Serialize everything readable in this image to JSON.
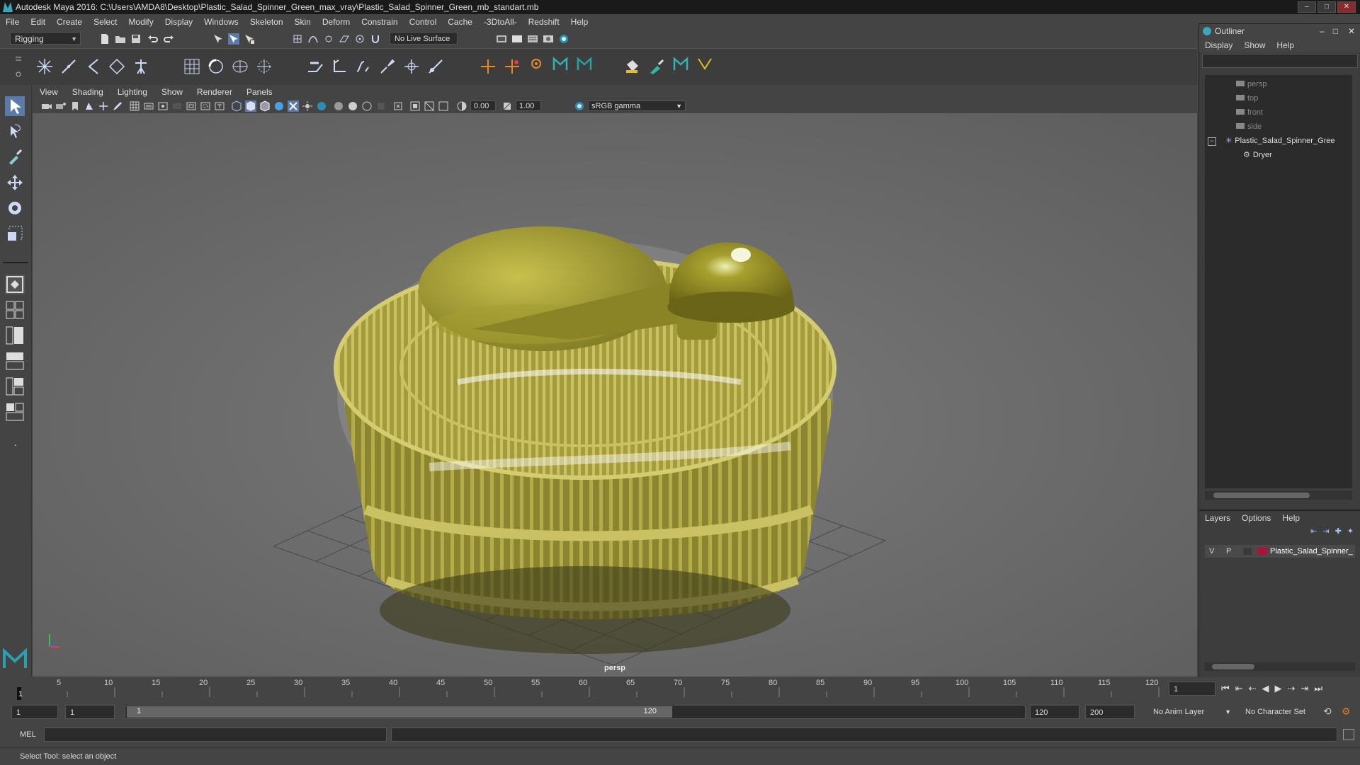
{
  "window": {
    "title": "Autodesk Maya 2016: C:\\Users\\AMDA8\\Desktop\\Plastic_Salad_Spinner_Green_max_vray\\Plastic_Salad_Spinner_Green_mb_standart.mb",
    "minimize": "–",
    "maximize": "□",
    "close": "✕"
  },
  "menubar": [
    "File",
    "Edit",
    "Create",
    "Select",
    "Modify",
    "Display",
    "Windows",
    "Skeleton",
    "Skin",
    "Deform",
    "Constrain",
    "Control",
    "Cache",
    "-3DtoAll-",
    "Redshift",
    "Help"
  ],
  "statusbar": {
    "menu_set": "Rigging",
    "live_surface": "No Live Surface"
  },
  "viewport": {
    "menu": [
      "View",
      "Shading",
      "Lighting",
      "Show",
      "Renderer",
      "Panels"
    ],
    "exposure": "0.00",
    "gamma": "1.00",
    "color_space": "sRGB gamma",
    "camera_label": "persp"
  },
  "outliner": {
    "title": "Outliner",
    "menu": [
      "Display",
      "Show",
      "Help"
    ],
    "items": [
      {
        "label": "persp",
        "dim": true
      },
      {
        "label": "top",
        "dim": true
      },
      {
        "label": "front",
        "dim": true
      },
      {
        "label": "side",
        "dim": true
      },
      {
        "label": "Plastic_Salad_Spinner_Gree",
        "dim": false
      },
      {
        "label": "Dryer",
        "dim": false
      }
    ]
  },
  "layers": {
    "menu": [
      "Layers",
      "Options",
      "Help"
    ],
    "layer": {
      "v": "V",
      "p": "P",
      "name": "Plastic_Salad_Spinner_",
      "color": "#b0103a"
    }
  },
  "timeline": {
    "ticks": [
      "5",
      "10",
      "15",
      "20",
      "25",
      "30",
      "35",
      "40",
      "45",
      "50",
      "55",
      "60",
      "65",
      "70",
      "75",
      "80",
      "85",
      "90",
      "95",
      "100",
      "105",
      "110",
      "115",
      "120"
    ],
    "start_tick": "1",
    "current_frame": "1"
  },
  "range": {
    "start": "1",
    "playback_start": "1",
    "slider_start": "1",
    "slider_end": "120",
    "playback_end": "120",
    "end": "200",
    "anim_layer": "No Anim Layer",
    "character_set": "No Character Set"
  },
  "command": {
    "label": "MEL"
  },
  "help_line": "Select Tool: select an object"
}
